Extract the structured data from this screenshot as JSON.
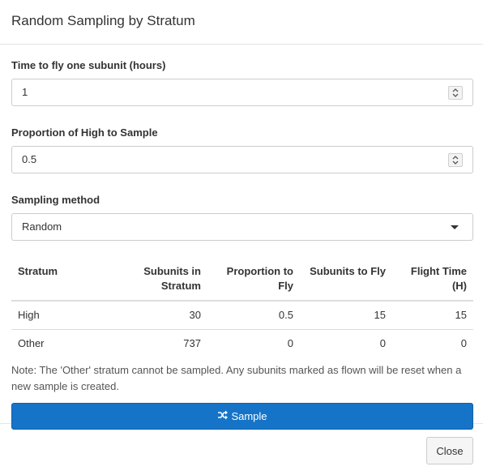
{
  "dialog": {
    "title": "Random Sampling by Stratum"
  },
  "form": {
    "time_label": "Time to fly one subunit (hours)",
    "time_value": "1",
    "proportion_label": "Proportion of High to Sample",
    "proportion_value": "0.5",
    "method_label": "Sampling method",
    "method_value": "Random"
  },
  "table": {
    "headers": {
      "stratum": "Stratum",
      "subunits_line1": "Subunits in",
      "subunits_line2": "Stratum",
      "proportion_line1": "Proportion to",
      "proportion_line2": "Fly",
      "to_fly": "Subunits to Fly",
      "flight_time": "Flight Time (H)"
    },
    "rows": [
      {
        "stratum": "High",
        "subunits": "30",
        "proportion": "0.5",
        "to_fly": "15",
        "flight_time": "15"
      },
      {
        "stratum": "Other",
        "subunits": "737",
        "proportion": "0",
        "to_fly": "0",
        "flight_time": "0"
      }
    ]
  },
  "note": "Note: The 'Other' stratum cannot be sampled. Any subunits marked as flown will be reset when a new sample is created.",
  "buttons": {
    "sample_label": "Sample",
    "sample_icon": "shuffle-icon",
    "close_label": "Close"
  },
  "colors": {
    "primary": "#1674c8"
  }
}
